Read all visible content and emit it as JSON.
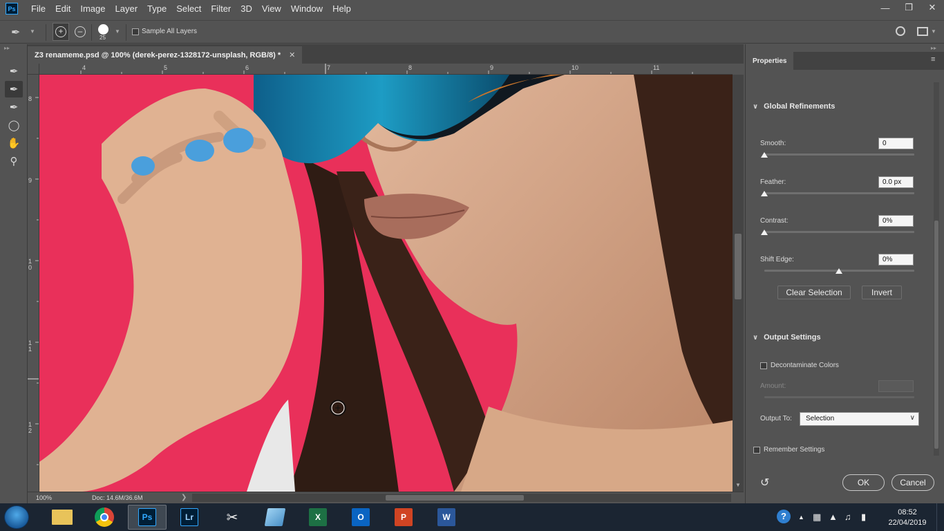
{
  "app": {
    "logo": "Ps"
  },
  "menu": [
    "File",
    "Edit",
    "Image",
    "Layer",
    "Type",
    "Select",
    "Filter",
    "3D",
    "View",
    "Window",
    "Help"
  ],
  "options_bar": {
    "brush_size": "25",
    "sample_all_layers_label": "Sample All Layers",
    "sample_all_layers_checked": false
  },
  "document": {
    "tab_title": "Z3 renameme.psd @ 100% (derek-perez-1328172-unsplash, RGB/8) *",
    "ruler_h": [
      "4",
      "5",
      "6",
      "7",
      "8",
      "9",
      "10",
      "11"
    ],
    "ruler_v": [
      "8",
      "9",
      "10",
      "11",
      "12"
    ],
    "zoom": "100%",
    "doc_info": "Doc: 14.6M/36.6M"
  },
  "properties": {
    "tab": "Properties",
    "global_refinements": {
      "title": "Global Refinements",
      "smooth": {
        "label": "Smooth:",
        "value": "0",
        "position": 0.0
      },
      "feather": {
        "label": "Feather:",
        "value": "0.0 px",
        "position": 0.0
      },
      "contrast": {
        "label": "Contrast:",
        "value": "0%",
        "position": 0.0
      },
      "shift_edge": {
        "label": "Shift Edge:",
        "value": "0%",
        "position": 0.5
      },
      "clear_selection": "Clear Selection",
      "invert": "Invert"
    },
    "output_settings": {
      "title": "Output Settings",
      "decontaminate_label": "Decontaminate Colors",
      "decontaminate_checked": false,
      "amount_label": "Amount:",
      "output_to_label": "Output To:",
      "output_to_value": "Selection"
    },
    "remember_settings_label": "Remember Settings",
    "remember_settings_checked": false,
    "ok": "OK",
    "cancel": "Cancel"
  },
  "taskbar": {
    "apps": [
      "file-explorer",
      "chrome",
      "photoshop",
      "lightroom",
      "snipping-tool",
      "notepad",
      "excel",
      "outlook",
      "powerpoint",
      "word"
    ],
    "ps_label": "Ps",
    "lr_label": "Lr",
    "x_label": "X",
    "o_label": "O",
    "p_label": "P",
    "w_label": "W",
    "time": "08:52",
    "date": "22/04/2019"
  },
  "colors": {
    "canvas_background": "#e9305a",
    "accent": "#31a8ff"
  }
}
